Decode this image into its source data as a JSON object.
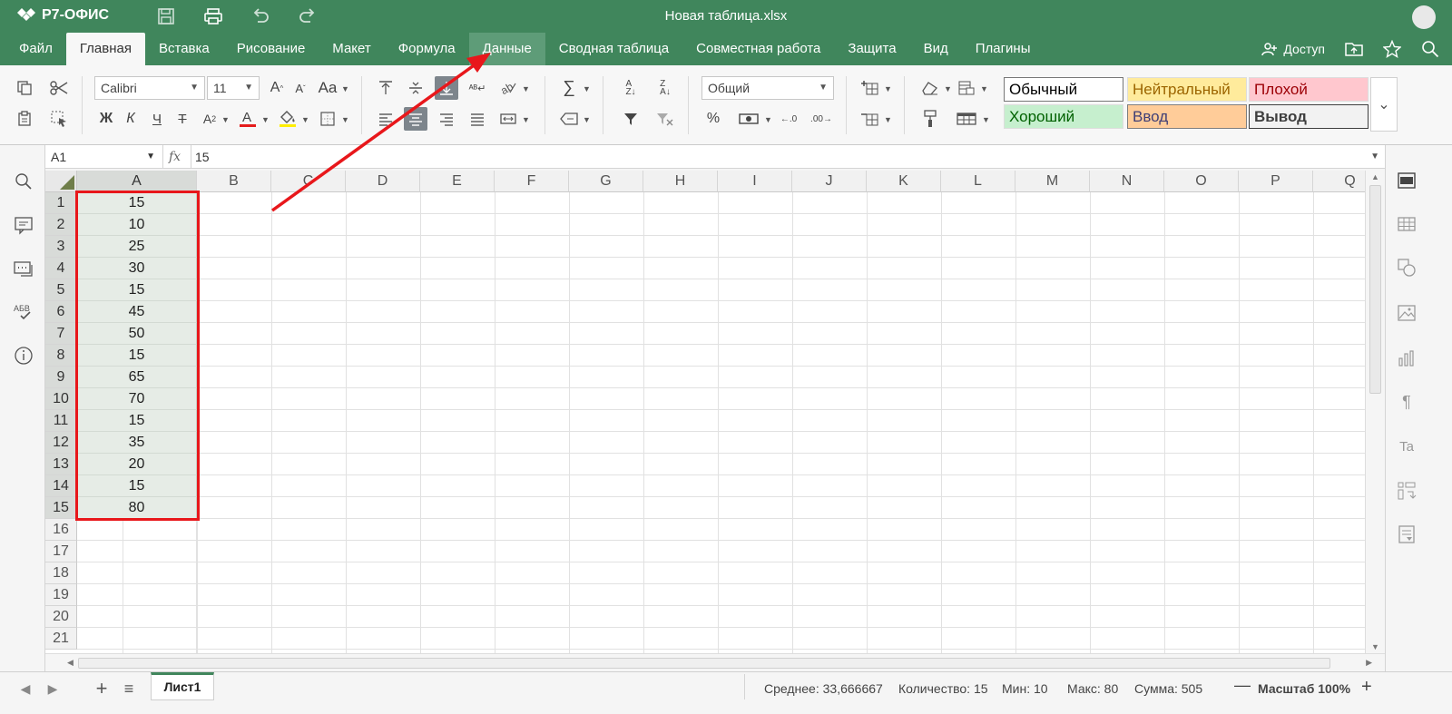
{
  "app": {
    "logo": "Р7-ОФИС",
    "doc_title": "Новая таблица.xlsx"
  },
  "tabs": [
    {
      "label": "Файл"
    },
    {
      "label": "Главная"
    },
    {
      "label": "Вставка"
    },
    {
      "label": "Рисование"
    },
    {
      "label": "Макет"
    },
    {
      "label": "Формула"
    },
    {
      "label": "Данные"
    },
    {
      "label": "Сводная таблица"
    },
    {
      "label": "Совместная работа"
    },
    {
      "label": "Защита"
    },
    {
      "label": "Вид"
    },
    {
      "label": "Плагины"
    }
  ],
  "active_tab": "Главная",
  "hovered_tab": "Данные",
  "access_label": "Доступ",
  "toolbar": {
    "font_name": "Calibri",
    "font_size": "11",
    "number_format": "Общий",
    "bold": "Ж",
    "italic": "К",
    "underline": "Ч",
    "strike": "Т",
    "font_color": "#e51c1c",
    "fill_color": "#ffee00"
  },
  "styles": [
    {
      "label": "Обычный",
      "bg": "#ffffff",
      "fg": "#000000",
      "border": "#777777"
    },
    {
      "label": "Нейтральный",
      "bg": "#ffeb9c",
      "fg": "#9c6500",
      "border": "#dddddd"
    },
    {
      "label": "Плохой",
      "bg": "#ffc7ce",
      "fg": "#9c0006",
      "border": "#dddddd"
    },
    {
      "label": "Хороший",
      "bg": "#c6efce",
      "fg": "#006100",
      "border": "#dddddd"
    },
    {
      "label": "Ввод",
      "bg": "#ffcc99",
      "fg": "#3f3f76",
      "border": "#7f7f7f"
    },
    {
      "label": "Вывод",
      "bg": "#f2f2f2",
      "fg": "#3f3f3f",
      "border": "#3f3f3f"
    }
  ],
  "formula_bar": {
    "name_box": "A1",
    "fx": "fx",
    "content": "15"
  },
  "columns": [
    "A",
    "B",
    "C",
    "D",
    "E",
    "F",
    "G",
    "H",
    "I",
    "J",
    "K",
    "L",
    "M",
    "N",
    "O",
    "P",
    "Q"
  ],
  "rows": [
    "1",
    "2",
    "3",
    "4",
    "5",
    "6",
    "7",
    "8",
    "9",
    "10",
    "11",
    "12",
    "13",
    "14",
    "15",
    "16",
    "17",
    "18",
    "19",
    "20",
    "21"
  ],
  "column_a_values": [
    "15",
    "10",
    "25",
    "30",
    "15",
    "45",
    "50",
    "15",
    "65",
    "70",
    "15",
    "35",
    "20",
    "15",
    "80"
  ],
  "sheet_tab": "Лист1",
  "status": {
    "average": "Среднее: 33,666667",
    "count": "Количество: 15",
    "min": "Мин: 10",
    "max": "Макс: 80",
    "sum": "Сумма: 505",
    "zoom": "Масштаб 100%"
  },
  "colors": {
    "brand": "#40865c",
    "annotation": "#e8171b"
  }
}
